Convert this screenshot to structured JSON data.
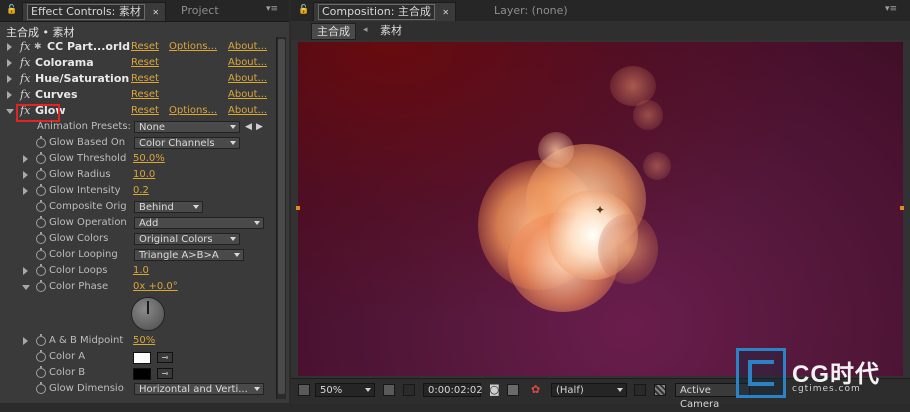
{
  "left_panel": {
    "tab_active": "Effect Controls: 素材",
    "tab_inactive": "Project",
    "header": "主合成 • 素材",
    "effects": [
      {
        "name": "CC Part...orld",
        "reset": "Reset",
        "options": "Options...",
        "about": "About..."
      },
      {
        "name": "Colorama",
        "reset": "Reset",
        "options": "",
        "about": "About..."
      },
      {
        "name": "Hue/Saturation",
        "reset": "Reset",
        "options": "",
        "about": "About..."
      },
      {
        "name": "Curves",
        "reset": "Reset",
        "options": "",
        "about": "About..."
      },
      {
        "name": "Glow",
        "reset": "Reset",
        "options": "Options...",
        "about": "About..."
      }
    ],
    "animation_presets": {
      "label": "Animation Presets:",
      "value": "None"
    },
    "properties": [
      {
        "label": "Glow Based On",
        "value": "Color Channels",
        "kind": "dropdown"
      },
      {
        "label": "Glow Threshold",
        "value": "50.0%",
        "kind": "value"
      },
      {
        "label": "Glow Radius",
        "value": "10.0",
        "kind": "value"
      },
      {
        "label": "Glow Intensity",
        "value": "0.2",
        "kind": "value"
      },
      {
        "label": "Composite Orig",
        "value": "Behind",
        "kind": "dropdown"
      },
      {
        "label": "Glow Operation",
        "value": "Add",
        "kind": "dropdown"
      },
      {
        "label": "Glow Colors",
        "value": "Original Colors",
        "kind": "dropdown"
      },
      {
        "label": "Color Looping",
        "value": "Triangle A>B>A",
        "kind": "dropdown"
      },
      {
        "label": "Color Loops",
        "value": "1.0",
        "kind": "value"
      },
      {
        "label": "Color Phase",
        "value": "0x +0.0°",
        "kind": "value"
      },
      {
        "label": "A & B Midpoint",
        "value": "50%",
        "kind": "value"
      },
      {
        "label": "Color A",
        "value": "",
        "kind": "color"
      },
      {
        "label": "Color B",
        "value": "",
        "kind": "color"
      },
      {
        "label": "Glow Dimensio",
        "value": "Horizontal and Verti...",
        "kind": "dropdown"
      }
    ],
    "colors": {
      "color_a": "#ffffff",
      "color_b": "#000000"
    }
  },
  "right_panel": {
    "tab_active": "Composition: 主合成",
    "tab_inactive": "Layer: (none)",
    "breadcrumb_active": "主合成",
    "breadcrumb_next": "素材",
    "bottom_bar": {
      "zoom": "50%",
      "timecode": "0:00:02:02",
      "resolution": "(Half)",
      "camera": "Active Camera"
    }
  },
  "watermark": {
    "logo": "CG时代",
    "url": "cgtimes.com"
  },
  "accent_color": "#d9a63a"
}
